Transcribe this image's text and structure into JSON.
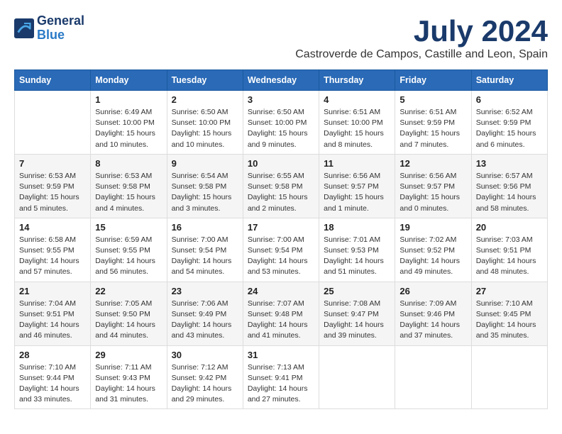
{
  "logo": {
    "general": "General",
    "blue": "Blue"
  },
  "header": {
    "month_title": "July 2024",
    "subtitle": "Castroverde de Campos, Castille and Leon, Spain"
  },
  "weekdays": [
    "Sunday",
    "Monday",
    "Tuesday",
    "Wednesday",
    "Thursday",
    "Friday",
    "Saturday"
  ],
  "weeks": [
    [
      {
        "day": "",
        "info": ""
      },
      {
        "day": "1",
        "info": "Sunrise: 6:49 AM\nSunset: 10:00 PM\nDaylight: 15 hours\nand 10 minutes."
      },
      {
        "day": "2",
        "info": "Sunrise: 6:50 AM\nSunset: 10:00 PM\nDaylight: 15 hours\nand 10 minutes."
      },
      {
        "day": "3",
        "info": "Sunrise: 6:50 AM\nSunset: 10:00 PM\nDaylight: 15 hours\nand 9 minutes."
      },
      {
        "day": "4",
        "info": "Sunrise: 6:51 AM\nSunset: 10:00 PM\nDaylight: 15 hours\nand 8 minutes."
      },
      {
        "day": "5",
        "info": "Sunrise: 6:51 AM\nSunset: 9:59 PM\nDaylight: 15 hours\nand 7 minutes."
      },
      {
        "day": "6",
        "info": "Sunrise: 6:52 AM\nSunset: 9:59 PM\nDaylight: 15 hours\nand 6 minutes."
      }
    ],
    [
      {
        "day": "7",
        "info": "Sunrise: 6:53 AM\nSunset: 9:59 PM\nDaylight: 15 hours\nand 5 minutes."
      },
      {
        "day": "8",
        "info": "Sunrise: 6:53 AM\nSunset: 9:58 PM\nDaylight: 15 hours\nand 4 minutes."
      },
      {
        "day": "9",
        "info": "Sunrise: 6:54 AM\nSunset: 9:58 PM\nDaylight: 15 hours\nand 3 minutes."
      },
      {
        "day": "10",
        "info": "Sunrise: 6:55 AM\nSunset: 9:58 PM\nDaylight: 15 hours\nand 2 minutes."
      },
      {
        "day": "11",
        "info": "Sunrise: 6:56 AM\nSunset: 9:57 PM\nDaylight: 15 hours\nand 1 minute."
      },
      {
        "day": "12",
        "info": "Sunrise: 6:56 AM\nSunset: 9:57 PM\nDaylight: 15 hours\nand 0 minutes."
      },
      {
        "day": "13",
        "info": "Sunrise: 6:57 AM\nSunset: 9:56 PM\nDaylight: 14 hours\nand 58 minutes."
      }
    ],
    [
      {
        "day": "14",
        "info": "Sunrise: 6:58 AM\nSunset: 9:55 PM\nDaylight: 14 hours\nand 57 minutes."
      },
      {
        "day": "15",
        "info": "Sunrise: 6:59 AM\nSunset: 9:55 PM\nDaylight: 14 hours\nand 56 minutes."
      },
      {
        "day": "16",
        "info": "Sunrise: 7:00 AM\nSunset: 9:54 PM\nDaylight: 14 hours\nand 54 minutes."
      },
      {
        "day": "17",
        "info": "Sunrise: 7:00 AM\nSunset: 9:54 PM\nDaylight: 14 hours\nand 53 minutes."
      },
      {
        "day": "18",
        "info": "Sunrise: 7:01 AM\nSunset: 9:53 PM\nDaylight: 14 hours\nand 51 minutes."
      },
      {
        "day": "19",
        "info": "Sunrise: 7:02 AM\nSunset: 9:52 PM\nDaylight: 14 hours\nand 49 minutes."
      },
      {
        "day": "20",
        "info": "Sunrise: 7:03 AM\nSunset: 9:51 PM\nDaylight: 14 hours\nand 48 minutes."
      }
    ],
    [
      {
        "day": "21",
        "info": "Sunrise: 7:04 AM\nSunset: 9:51 PM\nDaylight: 14 hours\nand 46 minutes."
      },
      {
        "day": "22",
        "info": "Sunrise: 7:05 AM\nSunset: 9:50 PM\nDaylight: 14 hours\nand 44 minutes."
      },
      {
        "day": "23",
        "info": "Sunrise: 7:06 AM\nSunset: 9:49 PM\nDaylight: 14 hours\nand 43 minutes."
      },
      {
        "day": "24",
        "info": "Sunrise: 7:07 AM\nSunset: 9:48 PM\nDaylight: 14 hours\nand 41 minutes."
      },
      {
        "day": "25",
        "info": "Sunrise: 7:08 AM\nSunset: 9:47 PM\nDaylight: 14 hours\nand 39 minutes."
      },
      {
        "day": "26",
        "info": "Sunrise: 7:09 AM\nSunset: 9:46 PM\nDaylight: 14 hours\nand 37 minutes."
      },
      {
        "day": "27",
        "info": "Sunrise: 7:10 AM\nSunset: 9:45 PM\nDaylight: 14 hours\nand 35 minutes."
      }
    ],
    [
      {
        "day": "28",
        "info": "Sunrise: 7:10 AM\nSunset: 9:44 PM\nDaylight: 14 hours\nand 33 minutes."
      },
      {
        "day": "29",
        "info": "Sunrise: 7:11 AM\nSunset: 9:43 PM\nDaylight: 14 hours\nand 31 minutes."
      },
      {
        "day": "30",
        "info": "Sunrise: 7:12 AM\nSunset: 9:42 PM\nDaylight: 14 hours\nand 29 minutes."
      },
      {
        "day": "31",
        "info": "Sunrise: 7:13 AM\nSunset: 9:41 PM\nDaylight: 14 hours\nand 27 minutes."
      },
      {
        "day": "",
        "info": ""
      },
      {
        "day": "",
        "info": ""
      },
      {
        "day": "",
        "info": ""
      }
    ]
  ]
}
